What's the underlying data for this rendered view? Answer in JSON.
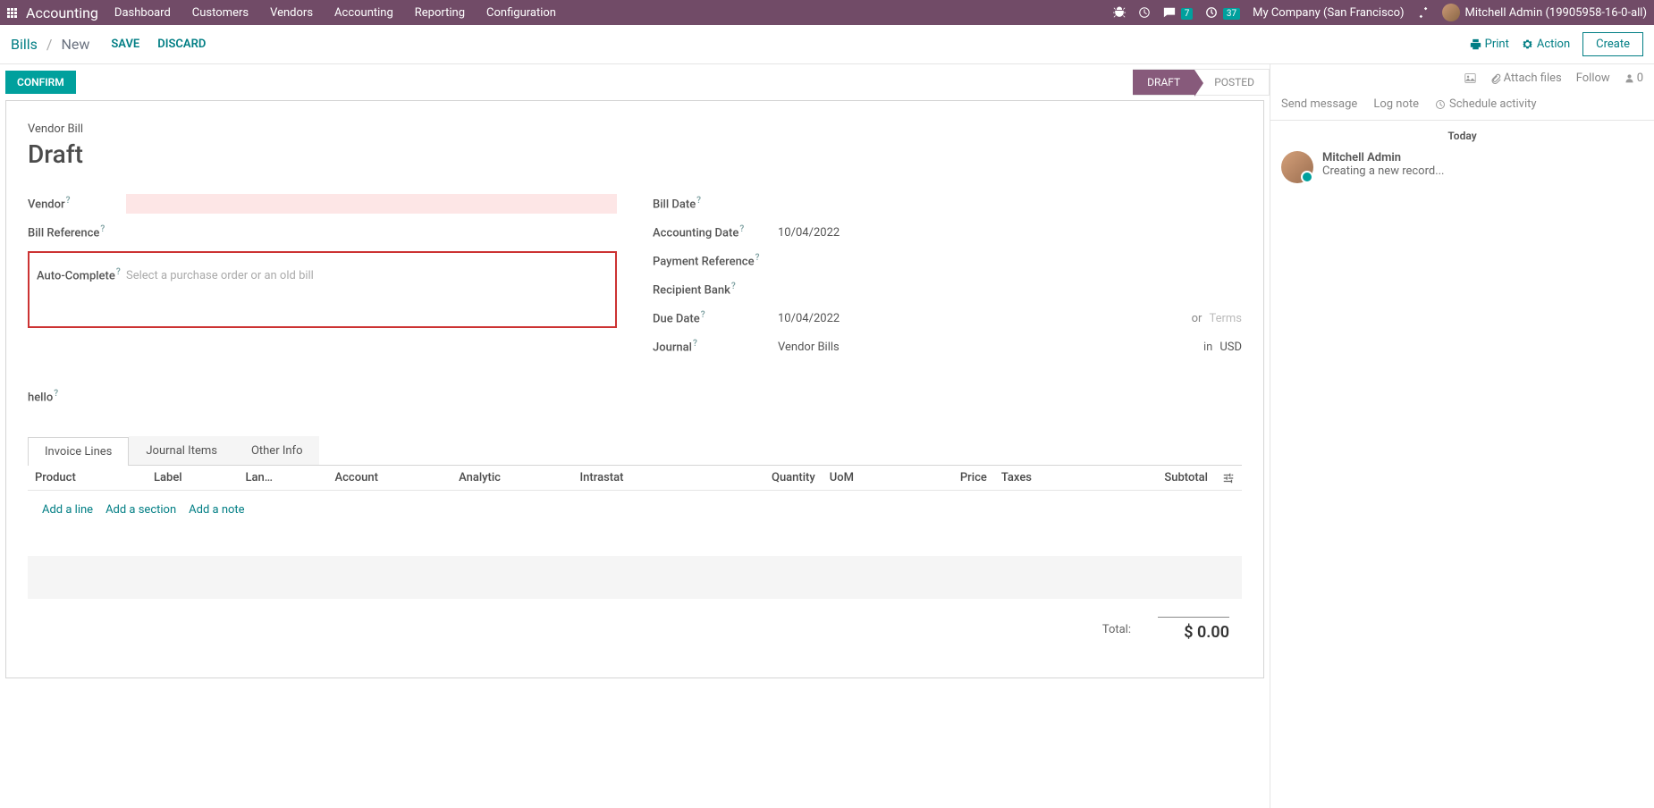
{
  "navbar": {
    "brand": "Accounting",
    "menu": [
      "Dashboard",
      "Customers",
      "Vendors",
      "Accounting",
      "Reporting",
      "Configuration"
    ],
    "msg_badge": "7",
    "activity_badge": "37",
    "company": "My Company (San Francisco)",
    "user": "Mitchell Admin (19905958-16-0-all)"
  },
  "control_bar": {
    "breadcrumb_root": "Bills",
    "breadcrumb_current": "New",
    "save": "SAVE",
    "discard": "DISCARD",
    "print": "Print",
    "action": "Action",
    "create": "Create"
  },
  "status": {
    "confirm": "CONFIRM",
    "draft": "DRAFT",
    "posted": "POSTED"
  },
  "form": {
    "subtitle": "Vendor Bill",
    "title": "Draft",
    "labels": {
      "vendor": "Vendor",
      "bill_ref": "Bill Reference",
      "auto_complete": "Auto-Complete",
      "auto_complete_ph": "Select a purchase order or an old bill",
      "bill_date": "Bill Date",
      "acct_date": "Accounting Date",
      "pay_ref": "Payment Reference",
      "recip_bank": "Recipient Bank",
      "due_date": "Due Date",
      "journal": "Journal",
      "hello": "hello"
    },
    "values": {
      "acct_date": "10/04/2022",
      "due_date": "10/04/2022",
      "or": "or",
      "terms_ph": "Terms",
      "journal": "Vendor Bills",
      "in": "in",
      "currency": "USD"
    }
  },
  "tabs": {
    "invoice_lines": "Invoice Lines",
    "journal_items": "Journal Items",
    "other_info": "Other Info"
  },
  "table": {
    "headers": {
      "product": "Product",
      "label": "Label",
      "lan": "Lan…",
      "account": "Account",
      "analytic": "Analytic",
      "intrastat": "Intrastat",
      "quantity": "Quantity",
      "uom": "UoM",
      "price": "Price",
      "taxes": "Taxes",
      "subtotal": "Subtotal"
    },
    "add_line": "Add a line",
    "add_section": "Add a section",
    "add_note": "Add a note"
  },
  "totals": {
    "label": "Total:",
    "amount": "$ 0.00"
  },
  "sidebar": {
    "attach": "Attach files",
    "follow": "Follow",
    "followers": "0",
    "send_msg": "Send message",
    "log_note": "Log note",
    "schedule": "Schedule activity",
    "today": "Today",
    "msg_author": "Mitchell Admin",
    "msg_text": "Creating a new record..."
  }
}
